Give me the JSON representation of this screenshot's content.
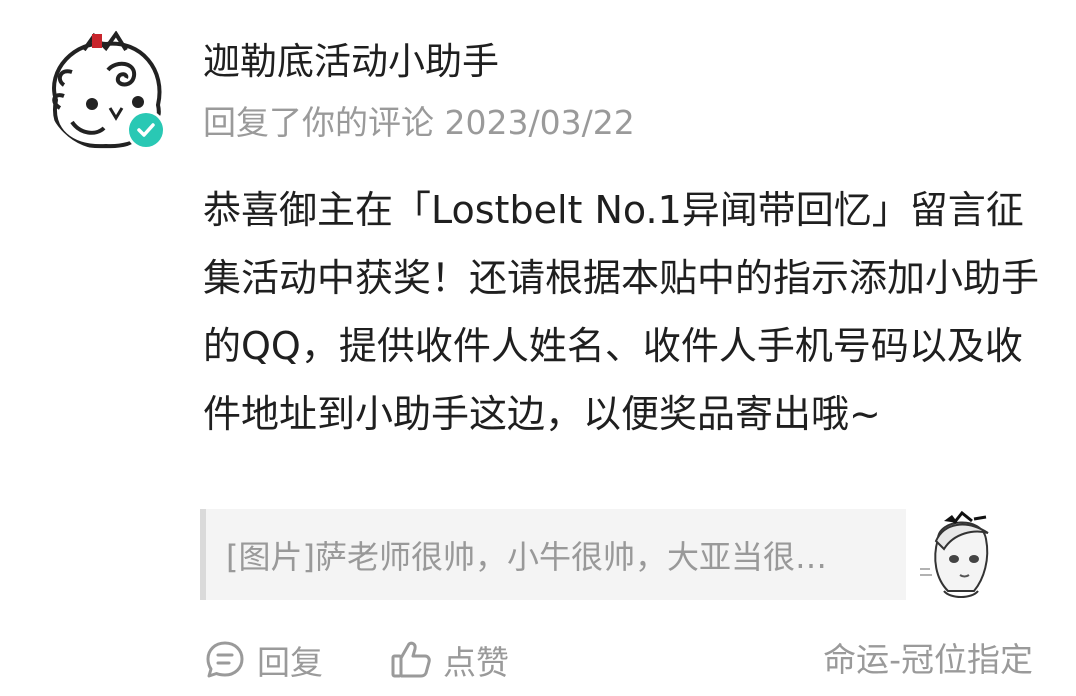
{
  "user": {
    "name": "迦勒底活动小助手",
    "avatar_icon": "cartoon-avatar-icon",
    "verified_icon": "verified-check-icon",
    "verified_color": "#29c8b4"
  },
  "meta": {
    "action": "回复了你的评论",
    "date": "2023/03/22"
  },
  "comment": {
    "body": "恭喜御主在「Lostbelt No.1异闻带回忆」留言征集活动中获奖！还请根据本贴中的指示添加小助手的QQ，提供收件人姓名、收件人手机号码以及收件地址到小助手这边，以便奖品寄出哦~"
  },
  "quoted": {
    "text": "[图片]萨老师很帅，小牛很帅，大亚当很…",
    "thumbnail_icon": "anime-character-thumbnail"
  },
  "actions": {
    "reply_label": "回复",
    "reply_icon": "reply-bubble-icon",
    "like_label": "点赞",
    "like_icon": "thumbs-up-icon"
  },
  "source": {
    "label": "命运-冠位指定"
  }
}
